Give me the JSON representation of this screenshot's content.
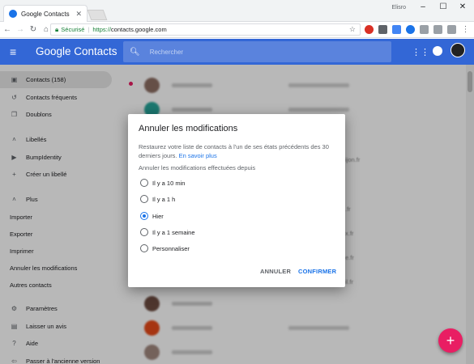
{
  "browser": {
    "tab_title": "Google Contacts",
    "user_label": "Elisro",
    "secure_label": "Sécurisé",
    "url_protocol": "https://",
    "url_host": "contacts.google.com"
  },
  "app": {
    "title": "Google Contacts",
    "search_placeholder": "Rechercher"
  },
  "sidebar": {
    "items": [
      {
        "label": "Contacts (158)",
        "icon": "contact-icon"
      },
      {
        "label": "Contacts fréquents",
        "icon": "history-icon"
      },
      {
        "label": "Doublons",
        "icon": "copy-icon"
      },
      {
        "label": "Libellés",
        "icon": "chevron-up-icon"
      },
      {
        "label": "BumpIdentity",
        "icon": "label-icon"
      },
      {
        "label": "Créer un libellé",
        "icon": "plus-icon"
      },
      {
        "label": "Plus",
        "icon": "chevron-up-icon"
      },
      {
        "label": "Importer"
      },
      {
        "label": "Exporter"
      },
      {
        "label": "Imprimer"
      },
      {
        "label": "Annuler les modifications"
      },
      {
        "label": "Autres contacts"
      },
      {
        "label": "Paramètres",
        "icon": "gear-icon"
      },
      {
        "label": "Laisser un avis",
        "icon": "feedback-icon"
      },
      {
        "label": "Aide",
        "icon": "help-icon"
      },
      {
        "label": "Passer à l'ancienne version",
        "icon": "exit-icon"
      }
    ]
  },
  "main": {
    "fragments": [
      "ijon.fr",
      ".fr",
      "x.fr",
      "e.fr",
      "il.fr"
    ]
  },
  "dialog": {
    "title": "Annuler les modifications",
    "body": "Restaurez votre liste de contacts à l'un de ses états précédents des 30 derniers jours.",
    "link": "En savoir plus",
    "subtitle": "Annuler les modifications effectuées depuis",
    "options": [
      {
        "label": "Il y a 10 min",
        "selected": false
      },
      {
        "label": "Il y a 1 h",
        "selected": false
      },
      {
        "label": "Hier",
        "selected": true
      },
      {
        "label": "Il y a 1 semaine",
        "selected": false
      },
      {
        "label": "Personnaliser",
        "selected": false
      }
    ],
    "cancel_label": "ANNULER",
    "confirm_label": "CONFIRMER"
  },
  "colors": {
    "app_bar": "#3367d6",
    "accent": "#1a73e8",
    "fab": "#e91e63"
  }
}
